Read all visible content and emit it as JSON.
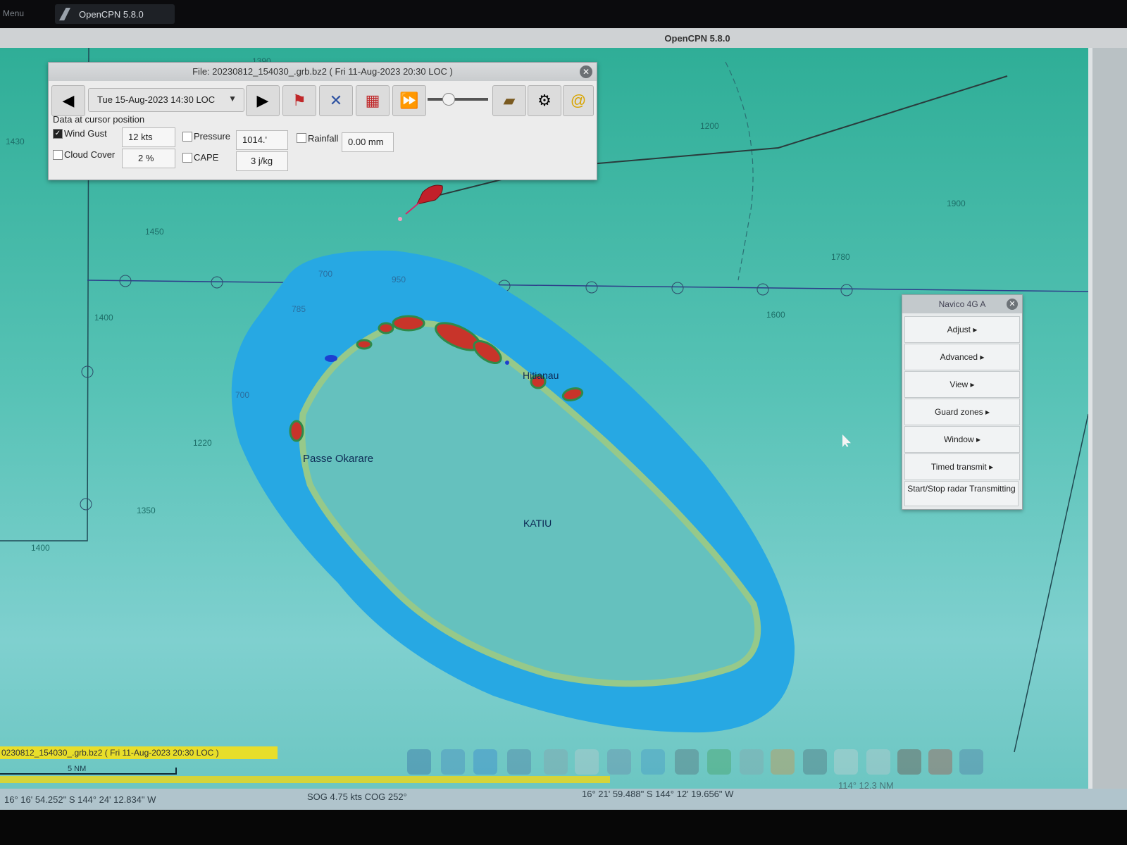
{
  "taskbar": {
    "menu_label": "Menu",
    "task_label": "OpenCPN 5.8.0"
  },
  "window": {
    "title": "OpenCPN 5.8.0"
  },
  "grib": {
    "file_title": "File: 20230812_154030_.grb.bz2 ( Fri 11-Aug-2023  20:30 LOC )",
    "date_select": "Tue 15-Aug-2023  14:30 LOC",
    "section_label": "Data at cursor position",
    "fields": {
      "wind_gust": {
        "label": "Wind Gust",
        "value": "12 kts",
        "checked": true
      },
      "pressure": {
        "label": "Pressure",
        "value": "1014.'",
        "checked": false
      },
      "rainfall": {
        "label": "Rainfall",
        "value": "0.00 mm",
        "checked": false
      },
      "cloud_cover": {
        "label": "Cloud Cover",
        "value": "2 %",
        "checked": false
      },
      "cape": {
        "label": "CAPE",
        "value": "3 j/kg",
        "checked": false
      }
    },
    "slider_level": 0.3
  },
  "chart": {
    "depths": [
      "1390",
      "1430",
      "1450",
      "1400",
      "1220",
      "1350",
      "1400",
      "1200",
      "1900",
      "1780",
      "1600",
      "700",
      "950",
      "785",
      "700"
    ],
    "places": {
      "pass": "Passe Okarare",
      "village": "Hitianau",
      "atoll": "KATIU"
    }
  },
  "radar_panel": {
    "title": "Navico 4G A",
    "buttons": [
      "Adjust ▸",
      "Advanced ▸",
      "View ▸",
      "Guard zones ▸",
      "Window ▸",
      "Timed transmit ▸",
      "Start/Stop radar Transmitting"
    ]
  },
  "bottom": {
    "grib_overlay": "0230812_154030_.grb.bz2 ( Fri 11-Aug-2023  20:30 LOC )",
    "scale_label": "5 NM"
  },
  "status": {
    "own_position": "16° 16' 54.252\" S   144° 24' 12.834\" W",
    "sog_cog": "SOG 4.75 kts  COG 252°",
    "cursor_position": "16° 21' 59.488\" S   144° 12' 19.656\" W",
    "bearing_range": "114°  12.3 NM"
  },
  "colors": {
    "chart_deep": "#2fae97",
    "shallow_blue": "#27a8e3",
    "lagoon": "#65c1be",
    "reef": "#96c98a",
    "rain_red": "#c8342a",
    "grib_bar": "#e8de2a"
  }
}
